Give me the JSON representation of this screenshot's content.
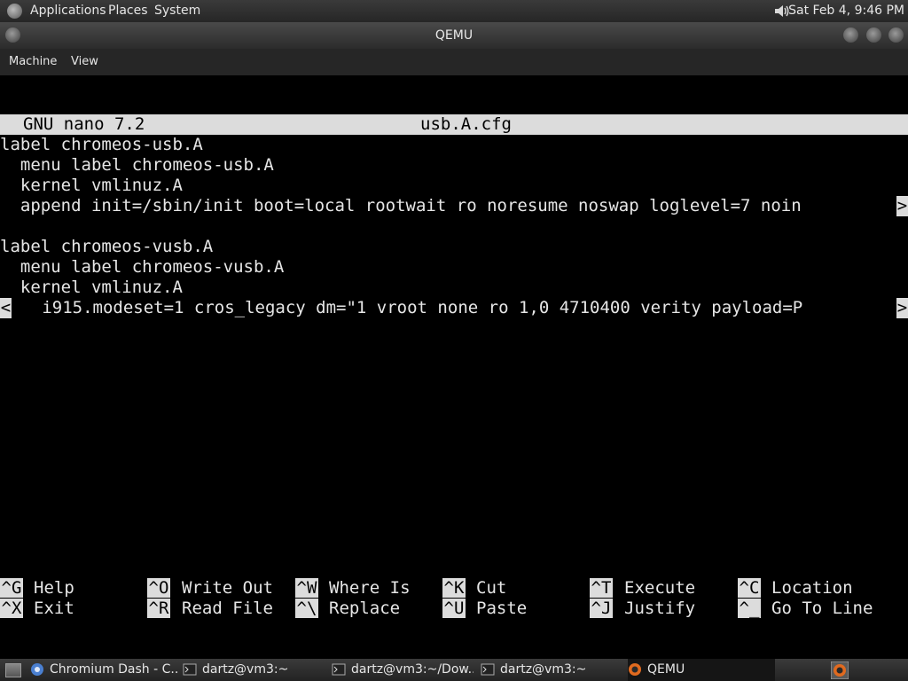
{
  "top_panel": {
    "menus": [
      "Applications",
      "Places",
      "System"
    ],
    "clock": "Sat Feb  4,  9:46 PM"
  },
  "window": {
    "title": "QEMU",
    "menus": [
      "Machine",
      "View"
    ]
  },
  "nano": {
    "version": "GNU nano 7.2",
    "filename": "usb.A.cfg",
    "lines": [
      "label chromeos-usb.A",
      "  menu label chromeos-usb.A",
      "  kernel vmlinuz.A",
      "  append init=/sbin/init boot=local rootwait ro noresume noswap loglevel=7 noin",
      "",
      "label chromeos-vusb.A",
      "  menu label chromeos-vusb.A",
      "  kernel vmlinuz.A",
      "   i915.modeset=1 cros_legacy dm=\"1 vroot none ro 1,0 4710400 verity payload=P"
    ],
    "line_marker_right": ">",
    "line_marker_left": "<",
    "shortcuts_row1": [
      {
        "key": "^G",
        "label": "Help"
      },
      {
        "key": "^O",
        "label": "Write Out"
      },
      {
        "key": "^W",
        "label": "Where Is"
      },
      {
        "key": "^K",
        "label": "Cut"
      },
      {
        "key": "^T",
        "label": "Execute"
      },
      {
        "key": "^C",
        "label": "Location"
      }
    ],
    "shortcuts_row2": [
      {
        "key": "^X",
        "label": "Exit"
      },
      {
        "key": "^R",
        "label": "Read File"
      },
      {
        "key": "^\\",
        "label": "Replace"
      },
      {
        "key": "^U",
        "label": "Paste"
      },
      {
        "key": "^J",
        "label": "Justify"
      },
      {
        "key": "^_",
        "label": "Go To Line"
      }
    ]
  },
  "taskbar": {
    "tasks": [
      "Chromium Dash - C...",
      "dartz@vm3:~",
      "dartz@vm3:~/Dow...",
      "dartz@vm3:~",
      "QEMU"
    ]
  }
}
